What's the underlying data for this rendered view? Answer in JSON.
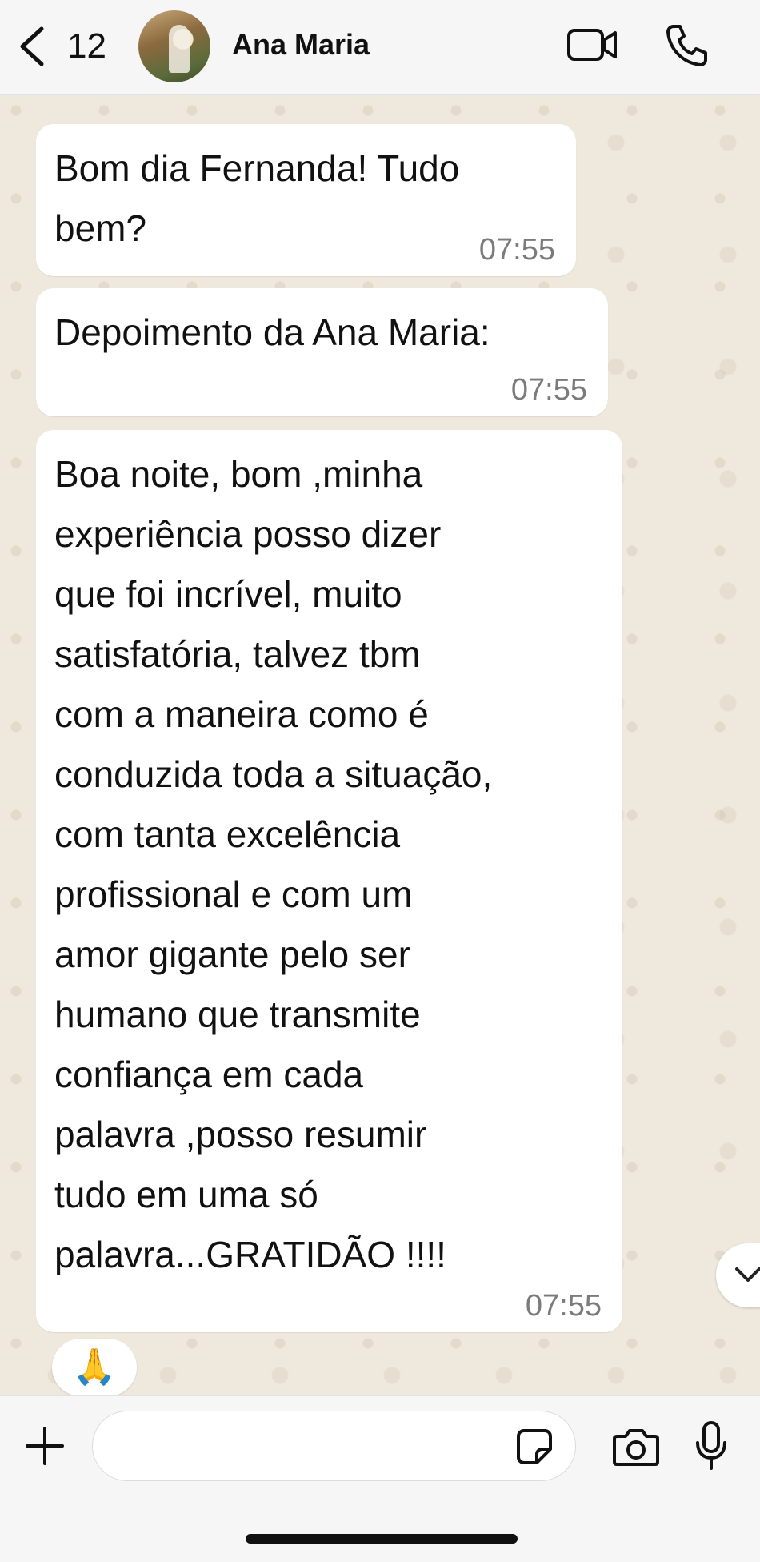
{
  "header": {
    "back_count": "12",
    "contact_name": "Ana Maria",
    "icons": [
      "chevron-left-icon",
      "video-icon",
      "phone-icon"
    ]
  },
  "messages": [
    {
      "text": "Bom dia Fernanda! Tudo\nbem?",
      "time": "07:55"
    },
    {
      "text": "Depoimento da Ana Maria:",
      "time": "07:55"
    },
    {
      "text": "Boa noite, bom ,minha\nexperiência posso dizer\nque foi incrível, muito\nsatisfatória, talvez tbm\ncom a maneira como é\nconduzida toda a situação,\ncom tanta excelência\nprofissional e com um\namor gigante pelo ser\nhumano que transmite\nconfiança em cada\npalavra ,posso resumir\ntudo em uma só\npalavra...GRATIDÃO !!!!",
      "time": "07:55"
    }
  ],
  "reaction": "🙏",
  "composer": {
    "input_value": "",
    "icons": [
      "plus-icon",
      "sticker-icon",
      "camera-icon",
      "microphone-icon"
    ]
  },
  "colors": {
    "wallpaper": "#efe9dd",
    "bubble": "#ffffff",
    "time_text": "#7b7b7b"
  }
}
